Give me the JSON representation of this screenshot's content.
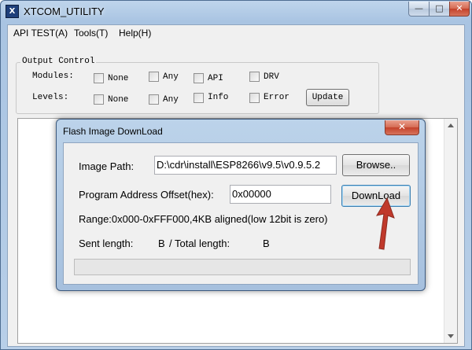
{
  "window": {
    "title": "XTCOM_UTILITY",
    "icon_glyph": "X",
    "minimize_glyph": "—",
    "maximize_glyph": "□",
    "close_glyph": "✕"
  },
  "menu": {
    "items": [
      {
        "label": "API TEST(A)"
      },
      {
        "label": "Tools(T)"
      },
      {
        "label": "Help(H)"
      }
    ]
  },
  "output_control": {
    "legend": "Output Control",
    "modules_label": "Modules:",
    "levels_label": "Levels:",
    "modules": [
      {
        "label": "None",
        "checked": false
      },
      {
        "label": "Any",
        "checked": false
      },
      {
        "label": "API",
        "checked": false
      },
      {
        "label": "DRV",
        "checked": false
      }
    ],
    "levels": [
      {
        "label": "None",
        "checked": false
      },
      {
        "label": "Any",
        "checked": false
      },
      {
        "label": "Info",
        "checked": false
      },
      {
        "label": "Error",
        "checked": false
      }
    ],
    "update_label": "Update"
  },
  "dialog": {
    "title": "Flash Image DownLoad",
    "close_glyph": "✕",
    "image_path_label": "Image Path:",
    "image_path_value": "D:\\cdr\\install\\ESP8266\\v9.5\\v0.9.5.2",
    "browse_label": "Browse..",
    "offset_label": "Program Address Offset(hex):",
    "offset_value": "0x00000",
    "download_label": "DownLoad",
    "range_text": "Range:0x000-0xFFF000,4KB aligned(low 12bit is zero)",
    "sent_label": "Sent length:",
    "sent_unit": "B",
    "total_label": "/ Total length:",
    "total_unit": "B",
    "progress": 0
  },
  "colors": {
    "annotation_arrow": "#c0392b",
    "close_button": "#c4412a"
  },
  "icons": [
    "app-icon",
    "minimize-icon",
    "maximize-icon",
    "close-icon",
    "scroll-up-icon",
    "scroll-down-icon"
  ]
}
